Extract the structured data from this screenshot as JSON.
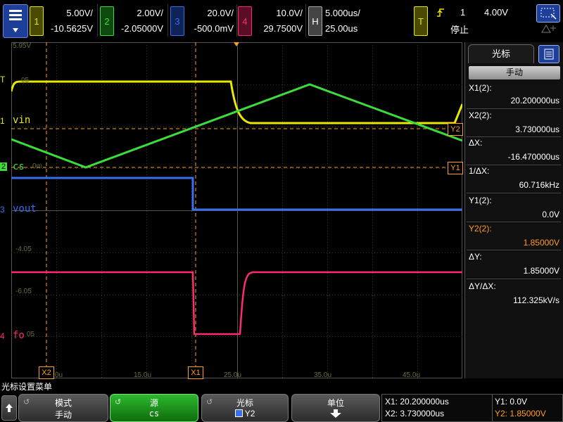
{
  "menu_icon": "menu-icon",
  "channels": [
    {
      "num": "1",
      "scale": "5.00V/",
      "offset": "-10.5625V",
      "color": "#e8e800"
    },
    {
      "num": "2",
      "scale": "2.00V/",
      "offset": "-2.05000V",
      "color": "#3ddc3d"
    },
    {
      "num": "3",
      "scale": "20.0V/",
      "offset": "-500.0mV",
      "color": "#3a6df0"
    },
    {
      "num": "4",
      "scale": "10.0V/",
      "offset": "29.7500V",
      "color": "#ff2a70"
    }
  ],
  "horizontal": {
    "label": "H",
    "scale": "5.000us/",
    "delay": "25.00us"
  },
  "trigger": {
    "label": "T",
    "source": "1",
    "level": "4.00V",
    "status": "停止"
  },
  "waveform_labels": {
    "vin": "vin",
    "cs": "cs",
    "vout": "vout",
    "fo": "fo",
    "ch1_marker": "1",
    "ch2_marker": "2",
    "ch3_marker": "3",
    "ch4_marker": "4",
    "trigger_marker": "T"
  },
  "grid_numbers": {
    "top_value": "5.95V",
    "v1": "05",
    "v2": "0m",
    "v3": "-4.05",
    "v4": "-6.05",
    "v5": "05",
    "t0": "0u",
    "t1": "15.0u",
    "t2": "25.0u",
    "t3": "35.0u",
    "t4": "45.0u"
  },
  "cursor_markers": {
    "x1": "X1",
    "x2": "X2",
    "y1": "Y1",
    "y2": "Y2"
  },
  "cursor_panel": {
    "title": "光标",
    "mode": "手动",
    "x1_label": "X1(2):",
    "x1_value": "20.200000us",
    "x2_label": "X2(2):",
    "x2_value": "3.730000us",
    "dx_label": "ΔX:",
    "dx_value": "-16.470000us",
    "inv_dx_label": "1/ΔX:",
    "inv_dx_value": "60.716kHz",
    "y1_label": "Y1(2):",
    "y1_value": "0.0V",
    "y2_label": "Y2(2):",
    "y2_value": "1.85000V",
    "dy_label": "ΔY:",
    "dy_value": "1.85000V",
    "dydx_label": "ΔY/ΔX:",
    "dydx_value": "112.325kV/s"
  },
  "status_line": "光标设置菜单",
  "softkeys": [
    {
      "top": "模式",
      "bottom": "手动"
    },
    {
      "top": "源",
      "bottom": "cs"
    },
    {
      "top": "光标",
      "bottom": "Y2"
    },
    {
      "top": "单位",
      "bottom": ""
    }
  ],
  "readout": {
    "x1": "X1:  20.200000us",
    "x2": "X2:  3.730000us",
    "y1": "Y1: 0.0V",
    "y2": "Y2: 1.85000V"
  },
  "colors": {
    "ch1": "#e8e800",
    "ch2": "#3ddc3d",
    "ch3": "#3a6df0",
    "ch4": "#ff2a70",
    "cursor": "#ff9f1a",
    "accent": "#1d3f9a"
  }
}
